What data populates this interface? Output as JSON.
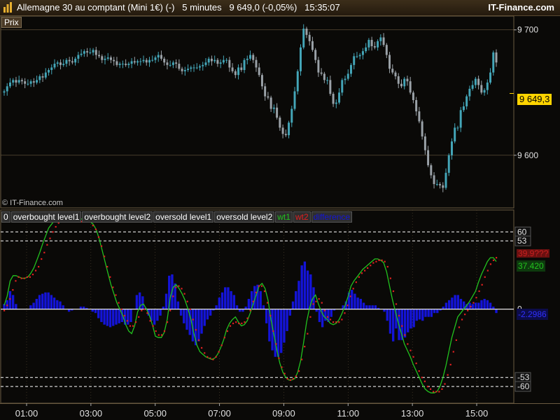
{
  "header": {
    "title": "Allemagne 30 au comptant (Mini 1€) (-)   5 minutes   9 649,0 (-0,05%)   15:35:07",
    "brand": "IT-Finance.com"
  },
  "price_panel": {
    "label": "Prix",
    "copyright": "© IT-Finance.com",
    "last_price": "9 649,3"
  },
  "indicator_panel": {
    "legend": [
      "0",
      "overbought level1",
      "overbought level2",
      "oversold level1",
      "oversold level2",
      "wt1",
      "wt2",
      "difference"
    ],
    "wt2_value": "39.9???",
    "wt1_value": "37.420",
    "diff_value": "-2.2986"
  },
  "colors": {
    "background": "#0a0907",
    "candle_up": "#44a6b8",
    "candle_down": "#9ba2a8",
    "wt1": "#22c21e",
    "wt2": "#e02020",
    "difference": "#1414d8",
    "grid": "#6a5a40",
    "level_lines": "#ffffff"
  },
  "chart_data": [
    {
      "type": "candlestick",
      "title": "Allemagne 30 au comptant (Mini 1€) (-)",
      "timeframe": "5 minutes",
      "y_ticks": [
        "9 700",
        "9 600"
      ],
      "ylim": [
        9558,
        9711
      ],
      "x_ticks": [
        "01:00",
        "03:00",
        "05:00",
        "07:00",
        "09:00",
        "11:00",
        "13:00",
        "15:00"
      ],
      "close": [
        9651,
        9655,
        9658,
        9660,
        9658,
        9660,
        9659,
        9657,
        9657,
        9659,
        9658,
        9660,
        9663,
        9662,
        9666,
        9668,
        9670,
        9673,
        9674,
        9672,
        9673,
        9676,
        9675,
        9674,
        9677,
        9680,
        9681,
        9683,
        9682,
        9682,
        9684,
        9680,
        9679,
        9676,
        9677,
        9678,
        9676,
        9675,
        9672,
        9673,
        9673,
        9672,
        9673,
        9675,
        9674,
        9675,
        9675,
        9676,
        9674,
        9676,
        9676,
        9678,
        9680,
        9677,
        9674,
        9672,
        9672,
        9674,
        9673,
        9669,
        9667,
        9668,
        9669,
        9670,
        9670,
        9670,
        9671,
        9672,
        9674,
        9677,
        9675,
        9676,
        9673,
        9674,
        9676,
        9676,
        9670,
        9667,
        9664,
        9670,
        9668,
        9676,
        9677,
        9680,
        9676,
        9670,
        9664,
        9655,
        9647,
        9646,
        9637,
        9638,
        9630,
        9622,
        9617,
        9616,
        9626,
        9637,
        9651,
        9667,
        9686,
        9701,
        9696,
        9691,
        9684,
        9676,
        9666,
        9665,
        9660,
        9660,
        9649,
        9641,
        9642,
        9650,
        9660,
        9661,
        9665,
        9672,
        9679,
        9679,
        9680,
        9683,
        9686,
        9692,
        9687,
        9686,
        9691,
        9694,
        9688,
        9680,
        9669,
        9666,
        9663,
        9657,
        9655,
        9661,
        9659,
        9650,
        9644,
        9635,
        9627,
        9615,
        9604,
        9592,
        9584,
        9577,
        9577,
        9576,
        9574,
        9586,
        9600,
        9611,
        9622,
        9622,
        9636,
        9639,
        9647,
        9653,
        9656,
        9661,
        9656,
        9650,
        9652,
        9658,
        9666,
        9682,
        9674
      ],
      "last_price": 9649.3
    },
    {
      "type": "line",
      "title": "WaveTrend oscillator",
      "x_ticks": [
        "01:00",
        "03:00",
        "05:00",
        "07:00",
        "09:00",
        "11:00",
        "13:00",
        "15:00"
      ],
      "ylim": [
        -73,
        77
      ],
      "levels": {
        "overbought level1": 60,
        "overbought level2": 53,
        "oversold level1": -53,
        "oversold level2": -60
      },
      "series": [
        {
          "name": "wt1",
          "values": [
            3,
            10,
            22,
            26,
            26,
            25,
            24,
            24,
            25,
            28,
            32,
            38,
            44,
            51,
            57,
            63,
            66,
            69,
            71,
            73,
            72,
            70,
            68,
            68,
            69,
            69,
            70,
            70,
            70,
            68,
            66,
            62,
            55,
            46,
            37,
            28,
            19,
            12,
            5,
            0,
            -5,
            -12,
            -17,
            -19,
            -13,
            -2,
            3,
            4,
            0,
            -5,
            -12,
            -21,
            -22,
            -22,
            -18,
            -8,
            9,
            17,
            19,
            16,
            12,
            7,
            0,
            -8,
            -19,
            -28,
            -33,
            -35,
            -37,
            -38,
            -39,
            -38,
            -35,
            -30,
            -24,
            -16,
            -11,
            -8,
            -6,
            -10,
            -13,
            -12,
            -9,
            -3,
            4,
            11,
            18,
            20,
            16,
            7,
            -8,
            -20,
            -32,
            -42,
            -49,
            -53,
            -55,
            -55,
            -54,
            -49,
            -40,
            -26,
            -10,
            1,
            8,
            11,
            4,
            -2,
            -6,
            -8,
            -11,
            -12,
            -11,
            -8,
            -3,
            3,
            10,
            18,
            22,
            25,
            28,
            31,
            33,
            35,
            37,
            39,
            39,
            38,
            36,
            29,
            18,
            7,
            -2,
            -11,
            -19,
            -27,
            -32,
            -37,
            -43,
            -48,
            -53,
            -58,
            -62,
            -64,
            -65,
            -65,
            -64,
            -60,
            -53,
            -44,
            -33,
            -22,
            -14,
            -6,
            -3,
            0,
            3,
            6,
            10,
            14,
            21,
            27,
            32,
            37,
            40,
            40,
            37
          ]
        },
        {
          "name": "wt2",
          "values": [
            -1,
            3,
            8,
            15,
            22,
            25,
            24,
            24,
            25,
            25,
            27,
            30,
            33,
            39,
            44,
            50,
            55,
            60,
            64,
            67,
            69,
            70,
            70,
            69,
            69,
            69,
            68,
            68,
            69,
            68,
            68,
            65,
            62,
            56,
            49,
            41,
            33,
            25,
            17,
            11,
            5,
            0,
            -5,
            -9,
            -13,
            -13,
            -10,
            -6,
            -1,
            0,
            -3,
            -9,
            -13,
            -17,
            -20,
            -20,
            -17,
            -10,
            -1,
            10,
            17,
            18,
            16,
            12,
            6,
            0,
            -8,
            -16,
            -24,
            -30,
            -34,
            -37,
            -38,
            -39,
            -37,
            -33,
            -28,
            -22,
            -17,
            -13,
            -11,
            -10,
            -11,
            -11,
            -10,
            -7,
            -1,
            6,
            13,
            18,
            18,
            14,
            5,
            -5,
            -17,
            -27,
            -38,
            -45,
            -50,
            -54,
            -55,
            -54,
            -52,
            -48,
            -39,
            -29,
            -19,
            -6,
            4,
            6,
            8,
            5,
            -1,
            -6,
            -8,
            -10,
            -10,
            -10,
            -8,
            -3,
            3,
            10,
            16,
            21,
            25,
            28,
            30,
            32,
            34,
            36,
            37,
            38,
            38,
            37,
            33,
            24,
            14,
            4,
            -5,
            -13,
            -20,
            -27,
            -32,
            -37,
            -42,
            -48,
            -53,
            -56,
            -60,
            -62,
            -64,
            -64,
            -64,
            -62,
            -58,
            -51,
            -43,
            -33,
            -24,
            -14,
            -8,
            -4,
            -1,
            2,
            5,
            9,
            14,
            19,
            25,
            30,
            35,
            38,
            40
          ]
        },
        {
          "name": "difference",
          "values": [
            4,
            7,
            14,
            11,
            4,
            0,
            0,
            0,
            0,
            3,
            5,
            8,
            11,
            12,
            13,
            13,
            11,
            9,
            7,
            6,
            3,
            0,
            -2,
            -1,
            0,
            0,
            2,
            2,
            1,
            0,
            -2,
            -3,
            -7,
            -10,
            -12,
            -13,
            -14,
            -13,
            -12,
            -11,
            -10,
            -12,
            -12,
            -10,
            0,
            11,
            13,
            10,
            1,
            -5,
            -9,
            -12,
            -9,
            -5,
            2,
            12,
            26,
            27,
            20,
            6,
            -5,
            -11,
            -16,
            -20,
            -25,
            -28,
            -25,
            -19,
            -13,
            -8,
            -5,
            -1,
            3,
            9,
            13,
            17,
            17,
            14,
            11,
            3,
            -2,
            -2,
            2,
            8,
            14,
            18,
            19,
            14,
            3,
            -11,
            -25,
            -32,
            -37,
            -37,
            -34,
            -26,
            -17,
            -5,
            6,
            14,
            22,
            34,
            37,
            30,
            27,
            17,
            -2,
            -10,
            -14,
            -9,
            -10,
            -6,
            -1,
            0,
            0,
            3,
            6,
            13,
            15,
            12,
            9,
            8,
            5,
            3,
            3,
            3,
            3,
            1,
            0,
            -2,
            -9,
            -19,
            -25,
            -15,
            -24,
            -24,
            -22,
            -18,
            -15,
            -14,
            -9,
            -8,
            -9,
            -6,
            -6,
            -6,
            -3,
            -3,
            -1,
            2,
            5,
            7,
            9,
            11,
            11,
            8,
            6,
            4,
            5,
            4,
            5,
            5,
            7,
            8,
            7,
            5,
            2,
            -3
          ]
        }
      ],
      "last_values": {
        "wt1": 37.42,
        "difference": -2.2986
      }
    }
  ]
}
